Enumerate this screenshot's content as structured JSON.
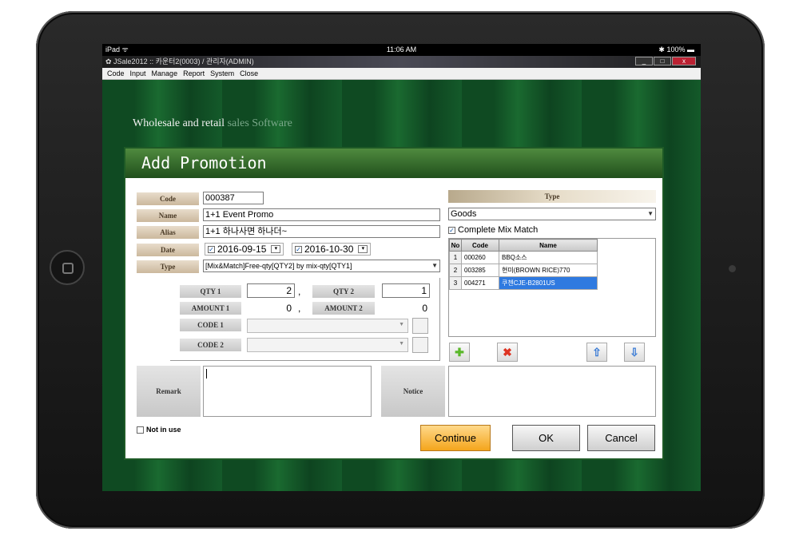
{
  "status": {
    "device": "iPad",
    "wifi_icon": "wifi-icon",
    "time": "11:06 AM",
    "battery": "100%"
  },
  "window": {
    "title": "JSale2012  ::  카운터2(0003) / 관리자(ADMIN)",
    "min": "_",
    "max": "□",
    "close": "x"
  },
  "menu": [
    "Code",
    "Input",
    "Manage",
    "Report",
    "System",
    "Close"
  ],
  "banner": {
    "title_main": "Wholesale and retail ",
    "title_sub": "sales Software"
  },
  "dialog": {
    "title": "Add Promotion",
    "labels": {
      "code": "Code",
      "name": "Name",
      "alias": "Alias",
      "date": "Date",
      "type": "Type",
      "remark": "Remark",
      "notice": "Notice"
    },
    "values": {
      "code": "000387",
      "name": "1+1 Event Promo",
      "alias": "1+1 하나사면 하나더~",
      "date_from": "2016-09-15",
      "date_to": "2016-10-30",
      "type": "[Mix&Match]Free-qty[QTY2] by mix-qty[QTY1]"
    },
    "sub": {
      "qty1_label": "QTY 1",
      "qty1": "2",
      "qty2_label": "QTY 2",
      "qty2": "1",
      "amount1_label": "AMOUNT 1",
      "amount1": "0",
      "amount2_label": "AMOUNT 2",
      "amount2": "0",
      "code1_label": "CODE 1",
      "code2_label": "CODE 2",
      "sep": ","
    },
    "right": {
      "type_header": "Type",
      "type_value": "Goods",
      "complete_mix": "Complete Mix Match",
      "grid_headers": [
        "No",
        "Code",
        "Name"
      ],
      "rows": [
        {
          "no": "1",
          "code": "000260",
          "name": "BBQ소스"
        },
        {
          "no": "2",
          "code": "003285",
          "name": "현미(BROWN RICE)770"
        },
        {
          "no": "3",
          "code": "004271",
          "name": "쿠첸CJE-B2801US"
        }
      ]
    },
    "not_in_use": "Not in use",
    "buttons": {
      "continue": "Continue",
      "ok": "OK",
      "cancel": "Cancel"
    }
  }
}
